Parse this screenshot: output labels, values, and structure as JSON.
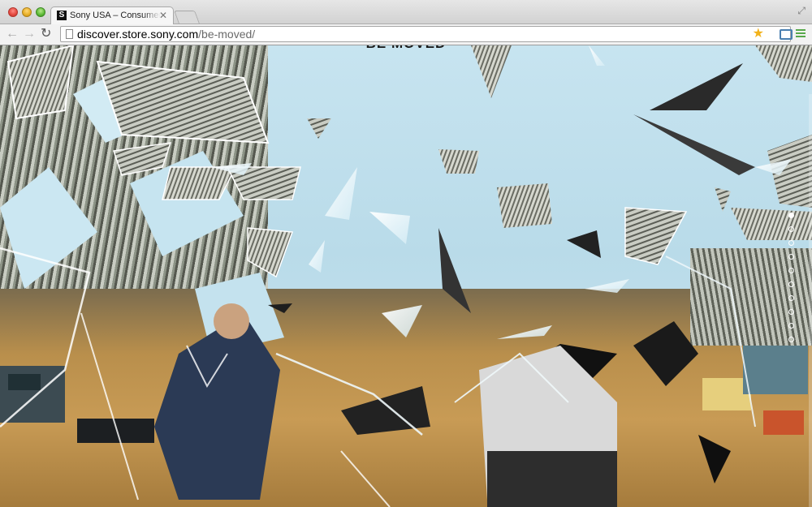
{
  "window": {
    "tab_title": "Sony USA – Consumer Electronics",
    "favicon_glyph": "S"
  },
  "toolbar": {
    "url_host": "discover.store.sony.com",
    "url_path": "/be-moved/"
  },
  "page": {
    "heading": "BE MOVED",
    "scene": "shattered glass fragments over a vintage laboratory photograph",
    "nav_dots": [
      {
        "active": true
      },
      {
        "active": false
      },
      {
        "active": false
      },
      {
        "active": false
      },
      {
        "active": false
      },
      {
        "active": false
      },
      {
        "active": false
      },
      {
        "active": false
      },
      {
        "active": false
      },
      {
        "active": false
      }
    ]
  },
  "colors": {
    "sky": "#c7e4f0",
    "desk": "#c89b55",
    "accent_star": "#f2b21a",
    "menu_green": "#57a84a"
  }
}
